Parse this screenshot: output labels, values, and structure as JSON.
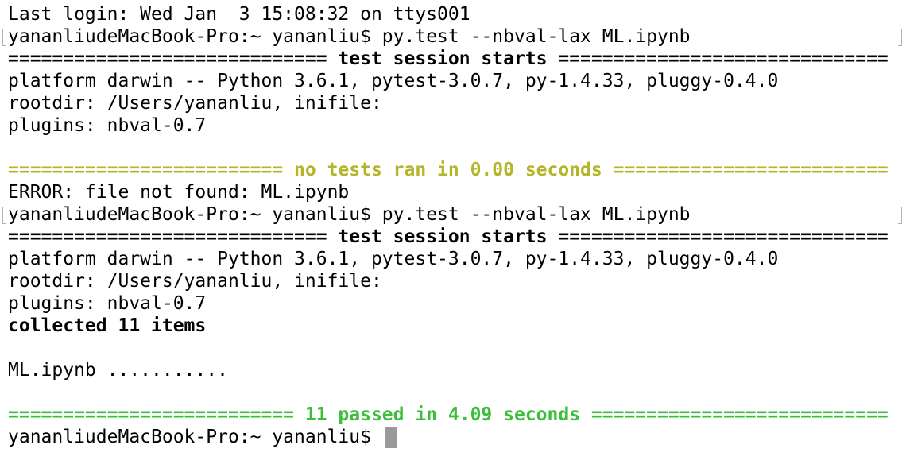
{
  "terminal": {
    "lines": [
      {
        "text": "Last login: Wed Jan  3 15:08:32 on ttys001",
        "style": "normal"
      },
      {
        "text": "yananliudeMacBook-Pro:~ yananliu$ py.test --nbval-lax ML.ipynb",
        "style": "normal"
      },
      {
        "text": "============================= test session starts ==============================",
        "style": "bold"
      },
      {
        "text": "platform darwin -- Python 3.6.1, pytest-3.0.7, py-1.4.33, pluggy-0.4.0",
        "style": "normal"
      },
      {
        "text": "rootdir: /Users/yananliu, inifile:",
        "style": "normal"
      },
      {
        "text": "plugins: nbval-0.7",
        "style": "normal"
      },
      {
        "text": "",
        "style": "normal"
      },
      {
        "text": "========================= no tests ran in 0.00 seconds =========================",
        "style": "yellow"
      },
      {
        "text": "ERROR: file not found: ML.ipynb",
        "style": "normal"
      },
      {
        "text": "yananliudeMacBook-Pro:~ yananliu$ py.test --nbval-lax ML.ipynb",
        "style": "normal"
      },
      {
        "text": "============================= test session starts ==============================",
        "style": "bold"
      },
      {
        "text": "platform darwin -- Python 3.6.1, pytest-3.0.7, py-1.4.33, pluggy-0.4.0",
        "style": "normal"
      },
      {
        "text": "rootdir: /Users/yananliu, inifile:",
        "style": "normal"
      },
      {
        "text": "plugins: nbval-0.7",
        "style": "normal"
      },
      {
        "text": "collected 11 items",
        "style": "bold"
      },
      {
        "text": "",
        "style": "normal"
      },
      {
        "text": "ML.ipynb ...........",
        "style": "normal"
      },
      {
        "text": "",
        "style": "normal"
      },
      {
        "text": "========================== 11 passed in 4.09 seconds ===========================",
        "style": "green"
      },
      {
        "text": "yananliudeMacBook-Pro:~ yananliu$ ",
        "style": "normal"
      }
    ],
    "colors": {
      "background": "#ffffff",
      "text": "#000000",
      "warning": "#b5b52a",
      "success": "#3bbf3b",
      "cursor": "#9a9a9a"
    }
  }
}
